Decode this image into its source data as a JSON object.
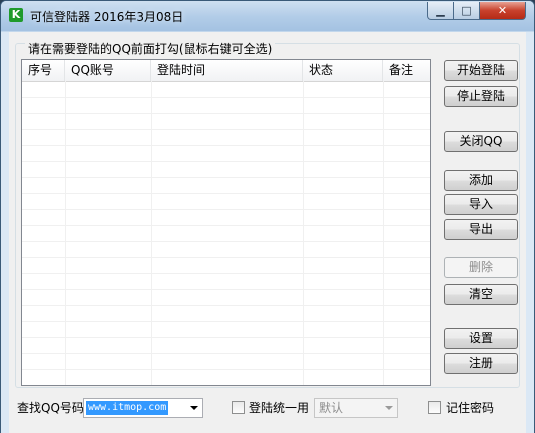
{
  "window": {
    "title": "可信登陆器 2016年3月08日",
    "app_icon_letter": "K",
    "minimize_glyph": "▁",
    "maximize_glyph": "□",
    "close_glyph": "✕"
  },
  "group": {
    "label": "请在需要登陆的QQ前面打勾(鼠标右键可全选)"
  },
  "table": {
    "columns": [
      "序号",
      "QQ账号",
      "登陆时间",
      "状态",
      "备注"
    ]
  },
  "buttons": {
    "start_login": "开始登陆",
    "stop_login": "停止登陆",
    "close_qq": "关闭QQ",
    "add": "添加",
    "import": "导入",
    "export": "导出",
    "delete": "删除",
    "clear": "清空",
    "settings": "设置",
    "register": "注册"
  },
  "bottom": {
    "search_label": "查找QQ号码",
    "search_value": "www.itmop.com",
    "unified_login_label": "登陆统一用",
    "unified_value": "默认",
    "remember_password_label": "记住密码"
  },
  "colors": {
    "selection": "#3399ff",
    "app_icon": "#1f9a2b",
    "close_button": "#c8412c"
  }
}
